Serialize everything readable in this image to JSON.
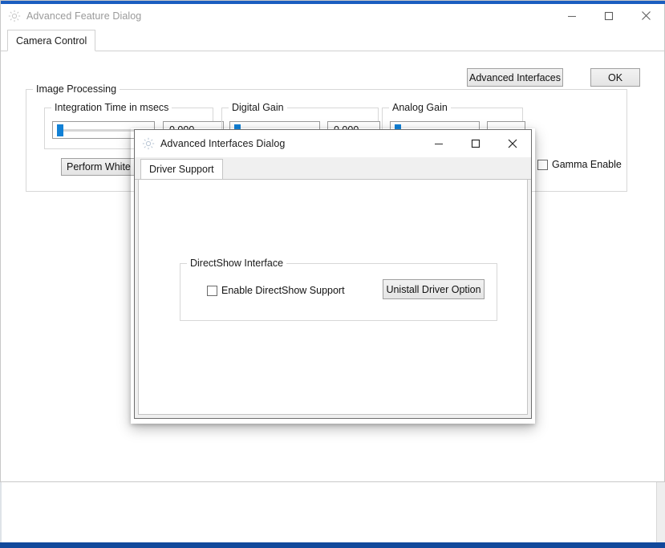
{
  "main_window": {
    "title": "Advanced Feature Dialog",
    "icon": "gear-sun-icon",
    "controls": {
      "minimize": "minimize-icon",
      "maximize": "maximize-icon",
      "close": "close-icon"
    },
    "tabs": [
      {
        "label": "Camera Control",
        "selected": true
      }
    ],
    "buttons": {
      "advanced_interfaces": "Advanced Interfaces",
      "ok": "OK"
    },
    "image_processing": {
      "label": "Image Processing",
      "groups": [
        {
          "label": "Integration Time in msecs",
          "slider_value": 0,
          "value_text": "0.000"
        },
        {
          "label": "Digital Gain",
          "slider_value": 0,
          "value_text": "0.000"
        },
        {
          "label": "Analog Gain",
          "slider_value": 0,
          "value_text": ""
        }
      ],
      "white_balance_button": "Perform White Balance",
      "gamma_checkbox": {
        "label": "Gamma Enable",
        "checked": false
      }
    }
  },
  "inner_window": {
    "title": "Advanced Interfaces Dialog",
    "icon": "gear-sun-icon",
    "controls": {
      "minimize": "minimize-icon",
      "maximize": "maximize-icon",
      "close": "close-icon"
    },
    "tabs": [
      {
        "label": "Driver Support",
        "selected": true
      }
    ],
    "directshow": {
      "group_label": "DirectShow Interface",
      "checkbox": {
        "label": "Enable DirectShow Support",
        "checked": false
      },
      "uninstall_button": "Unistall Driver Option"
    }
  },
  "colors": {
    "title_accent": "#1b5dc0",
    "slider_thumb": "#1281d6",
    "taskbar": "#12499b"
  }
}
